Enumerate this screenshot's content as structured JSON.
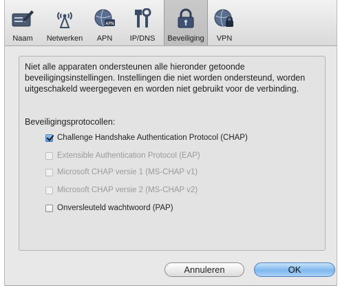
{
  "tabs": [
    {
      "label": "Naam",
      "icon": "pencil-card-icon"
    },
    {
      "label": "Netwerken",
      "icon": "antenna-icon"
    },
    {
      "label": "APN",
      "icon": "globe-apn-icon"
    },
    {
      "label": "IP/DNS",
      "icon": "tools-icon"
    },
    {
      "label": "Beveiliging",
      "icon": "lock-icon",
      "selected": true
    },
    {
      "label": "VPN",
      "icon": "globe-lock-icon"
    }
  ],
  "panel": {
    "info_text": "Niet alle apparaten ondersteunen alle hieronder getoonde beveiligingsinstellingen. Instellingen die niet worden ondersteund, worden uitgeschakeld weergegeven en worden niet gebruikt voor de verbinding.",
    "section_title": "Beveiligingsprotocollen:",
    "options": [
      {
        "label": "Challenge Handshake Authentication Protocol (CHAP)",
        "checked": true,
        "enabled": true
      },
      {
        "label": "Extensible Authentication Protocol (EAP)",
        "checked": false,
        "enabled": false
      },
      {
        "label": "Microsoft CHAP versie 1 (MS-CHAP v1)",
        "checked": false,
        "enabled": false
      },
      {
        "label": "Microsoft CHAP versie 2 (MS-CHAP v2)",
        "checked": false,
        "enabled": false
      },
      {
        "label": "Onversleuteld wachtwoord (PAP)",
        "checked": false,
        "enabled": true
      }
    ]
  },
  "buttons": {
    "cancel": "Annuleren",
    "ok": "OK"
  },
  "colors": {
    "accent": "#7fb8ee",
    "window": "#e8e8e8"
  }
}
